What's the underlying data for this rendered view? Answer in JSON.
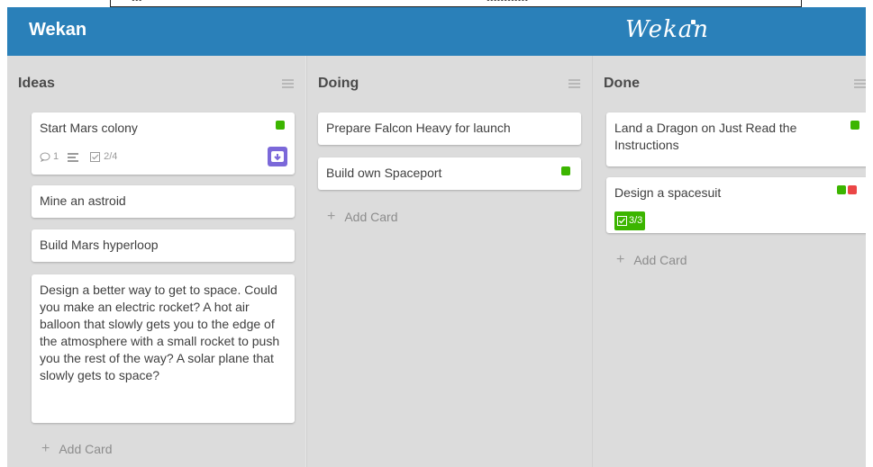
{
  "top_fragments": [
    "•••",
    "••••••••••••"
  ],
  "header": {
    "board_title": "Wekan",
    "logo_text": "Wekan",
    "background_color": "#2a80b9"
  },
  "lists": [
    {
      "title": "Ideas",
      "cards": [
        {
          "title": "Start Mars colony",
          "labels": [
            "green"
          ],
          "comments": "1",
          "checklist": "2/4",
          "has_description": true,
          "has_member": true
        },
        {
          "title": "Mine an astroid"
        },
        {
          "title": "Build Mars hyperloop"
        },
        {
          "title": "Design a better way to get to space. Could you make an electric rocket? A hot air balloon that slowly gets you to the edge of the atmosphere with a small rocket to push you the rest of the way? A solar plane that slowly gets to space?"
        }
      ],
      "add_card": "Add Card"
    },
    {
      "title": "Doing",
      "cards": [
        {
          "title": "Prepare Falcon Heavy for launch"
        },
        {
          "title": "Build own Spaceport",
          "labels": [
            "green"
          ]
        }
      ],
      "add_card": "Add Card"
    },
    {
      "title": "Done",
      "cards": [
        {
          "title": "Land a Dragon on Just Read the Instructions",
          "labels": [
            "green"
          ]
        },
        {
          "title": "Design a spacesuit",
          "labels": [
            "green",
            "red"
          ],
          "checklist_complete": "3/3"
        }
      ],
      "add_card": "Add Card"
    }
  ],
  "colors": {
    "label_green": "#3cb500",
    "label_red": "#eb4646",
    "member_purple": "#7b68d9"
  }
}
